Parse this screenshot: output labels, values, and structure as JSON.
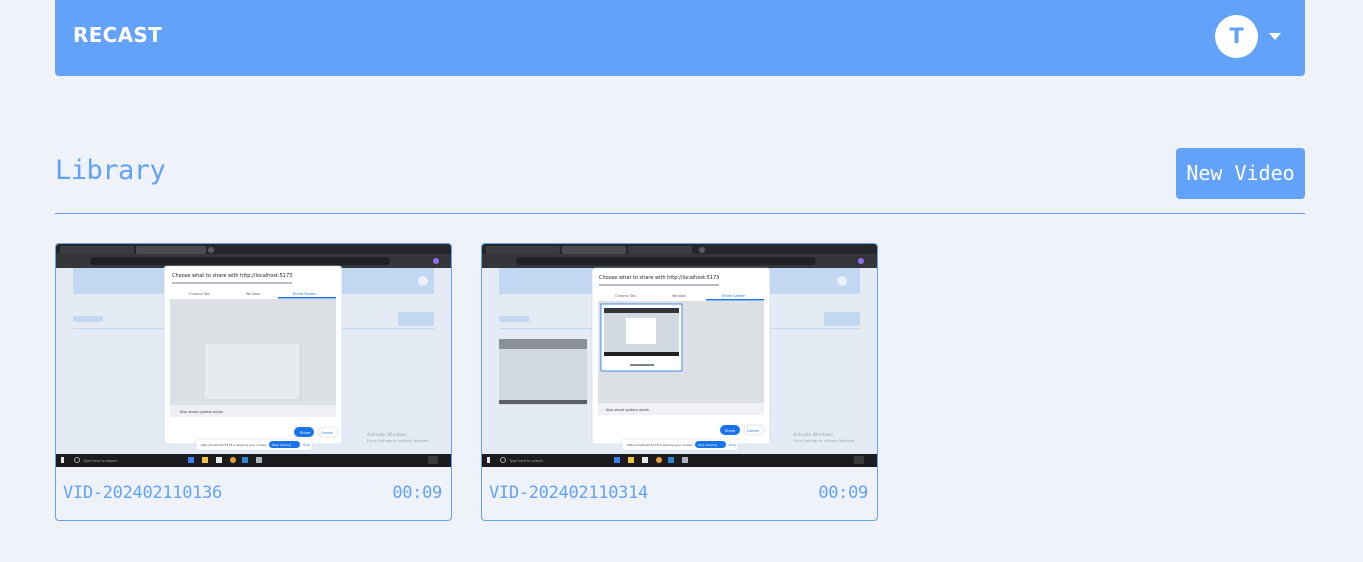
{
  "header": {
    "brand": "RECAST",
    "avatar_initial": "T",
    "menu_icon": "caret-down-icon"
  },
  "library": {
    "title": "Library",
    "new_video_label": "New Video",
    "videos": [
      {
        "name": "VID-202402110136",
        "duration": "00:09",
        "thumbnail": {
          "dialog_title": "Choose what to share with http://localhost:5173",
          "tabs": [
            "Chrome Tab",
            "Window",
            "Entire Screen"
          ],
          "audio_label": "Also share system audio",
          "share_label": "Share",
          "cancel_label": "Cancel",
          "notice": "http://localhost:5173 is sharing your screen.",
          "stop_label": "Stop sharing",
          "hide_label": "Hide",
          "watermark_1": "Activate Windows",
          "watermark_2": "Go to Settings to activate Windows.",
          "search_label": "Type here to search"
        }
      },
      {
        "name": "VID-202402110314",
        "duration": "00:09",
        "thumbnail": {
          "dialog_title": "Choose what to share with http://localhost:5173",
          "tabs": [
            "Chrome Tab",
            "Window",
            "Entire Screen"
          ],
          "audio_label": "Also share system audio",
          "share_label": "Share",
          "cancel_label": "Cancel",
          "notice": "http://localhost:5173 is sharing your screen.",
          "stop_label": "Stop sharing",
          "hide_label": "Hide",
          "watermark_1": "Activate Windows",
          "watermark_2": "Go to Settings to activate Windows.",
          "search_label": "Type here to search"
        }
      }
    ]
  },
  "colors": {
    "accent": "#62a2f8",
    "background": "#eff3f9",
    "white": "#ffffff",
    "taskbar": "#1c1c1e",
    "dialog_button": "#1a73e8"
  }
}
